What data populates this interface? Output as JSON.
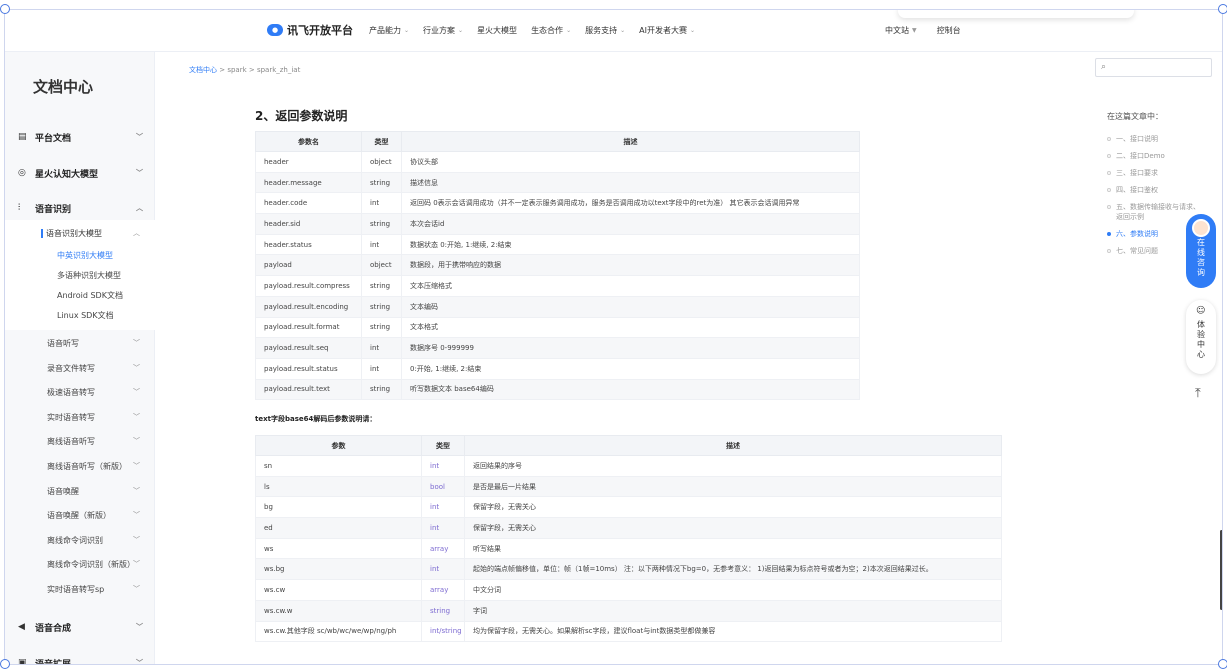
{
  "nav": {
    "logo": "讯飞开放平台",
    "logo_mark": "iFlytek",
    "items": [
      "产品能力",
      "行业方案",
      "星火大模型",
      "生态合作",
      "服务支持",
      "AI开发者大赛"
    ],
    "lang": "中文站",
    "console": "控制台"
  },
  "sidebar": {
    "title": "文档中心",
    "sections": [
      {
        "label": "平台文档",
        "icon": "doc-icon"
      },
      {
        "label": "星火认知大模型",
        "icon": "spark-icon"
      },
      {
        "label": "语音识别",
        "icon": "mic-icon"
      }
    ],
    "subhead": "语音识别大模型",
    "leaves": [
      "中英识别大模型",
      "多语种识别大模型",
      "Android SDK文档",
      "Linux SDK文档"
    ],
    "items": [
      "语音听写",
      "录音文件转写",
      "极速语音转写",
      "实时语音转写",
      "离线语音听写",
      "离线语音听写（新版）",
      "语音唤醒",
      "语音唤醒（新版）",
      "离线命令词识别",
      "离线命令词识别（新版）",
      "实时语音转写sp"
    ],
    "bottom_sections": [
      {
        "label": "语音合成",
        "icon": "speaker-icon"
      },
      {
        "label": "语音扩展",
        "icon": "extend-icon"
      }
    ]
  },
  "breadcrumb": {
    "home": "文档中心",
    "rest": " > spark > spark_zh_iat"
  },
  "heading": "2、返回参数说明",
  "table1": {
    "headers": [
      "参数名",
      "类型",
      "描述"
    ],
    "rows": [
      [
        "header",
        "object",
        "协议头部"
      ],
      [
        "header.message",
        "string",
        "描述信息"
      ],
      [
        "header.code",
        "int",
        "返回码 0表示会话调用成功（并不一定表示服务调用成功，服务是否调用成功以text字段中的ret为准） 其它表示会话调用异常"
      ],
      [
        "header.sid",
        "string",
        "本次会话id"
      ],
      [
        "header.status",
        "int",
        "数据状态 0:开始, 1:继续, 2:结束"
      ],
      [
        "payload",
        "object",
        "数据段，用于携带响应的数据"
      ],
      [
        "payload.result.compress",
        "string",
        "文本压缩格式"
      ],
      [
        "payload.result.encoding",
        "string",
        "文本编码"
      ],
      [
        "payload.result.format",
        "string",
        "文本格式"
      ],
      [
        "payload.result.seq",
        "int",
        "数据序号 0-999999"
      ],
      [
        "payload.result.status",
        "int",
        "0:开始, 1:继续, 2:结束"
      ],
      [
        "payload.result.text",
        "string",
        "听写数据文本 base64编码"
      ]
    ]
  },
  "note": "text字段base64解码后参数说明请：",
  "table2": {
    "headers": [
      "参数",
      "类型",
      "描述"
    ],
    "rows": [
      [
        "sn",
        "int",
        "返回结果的序号"
      ],
      [
        "ls",
        "bool",
        "是否是最后一片结果"
      ],
      [
        "bg",
        "int",
        "保留字段，无需关心"
      ],
      [
        "ed",
        "int",
        "保留字段，无需关心"
      ],
      [
        "ws",
        "array",
        "听写结果"
      ],
      [
        "ws.bg",
        "int",
        "起始的端点帧偏移值，单位：帧（1帧=10ms） 注：以下两种情况下bg=0，无参考意义： 1)返回结果为标点符号或者为空；2)本次返回结果过长。"
      ],
      [
        "ws.cw",
        "array",
        "中文分词"
      ],
      [
        "ws.cw.w",
        "string",
        "字词"
      ],
      [
        "ws.cw.其他字段 sc/wb/wc/we/wp/ng/ph",
        "int/string",
        "均为保留字段，无需关心。如果解析sc字段，建议float与int数据类型都做兼容"
      ]
    ]
  },
  "toc": {
    "title": "在这篇文章中：",
    "items": [
      "一、接口说明",
      "二、接口Demo",
      "三、接口要求",
      "四、接口鉴权",
      "五、数据传输接收与请求、返回示例",
      "六、参数说明",
      "七、常见问题"
    ],
    "active_index": 5
  },
  "float": {
    "consult": "在线咨询",
    "experience": "体验中心"
  },
  "colors": {
    "accent": "#2f7cf6"
  }
}
